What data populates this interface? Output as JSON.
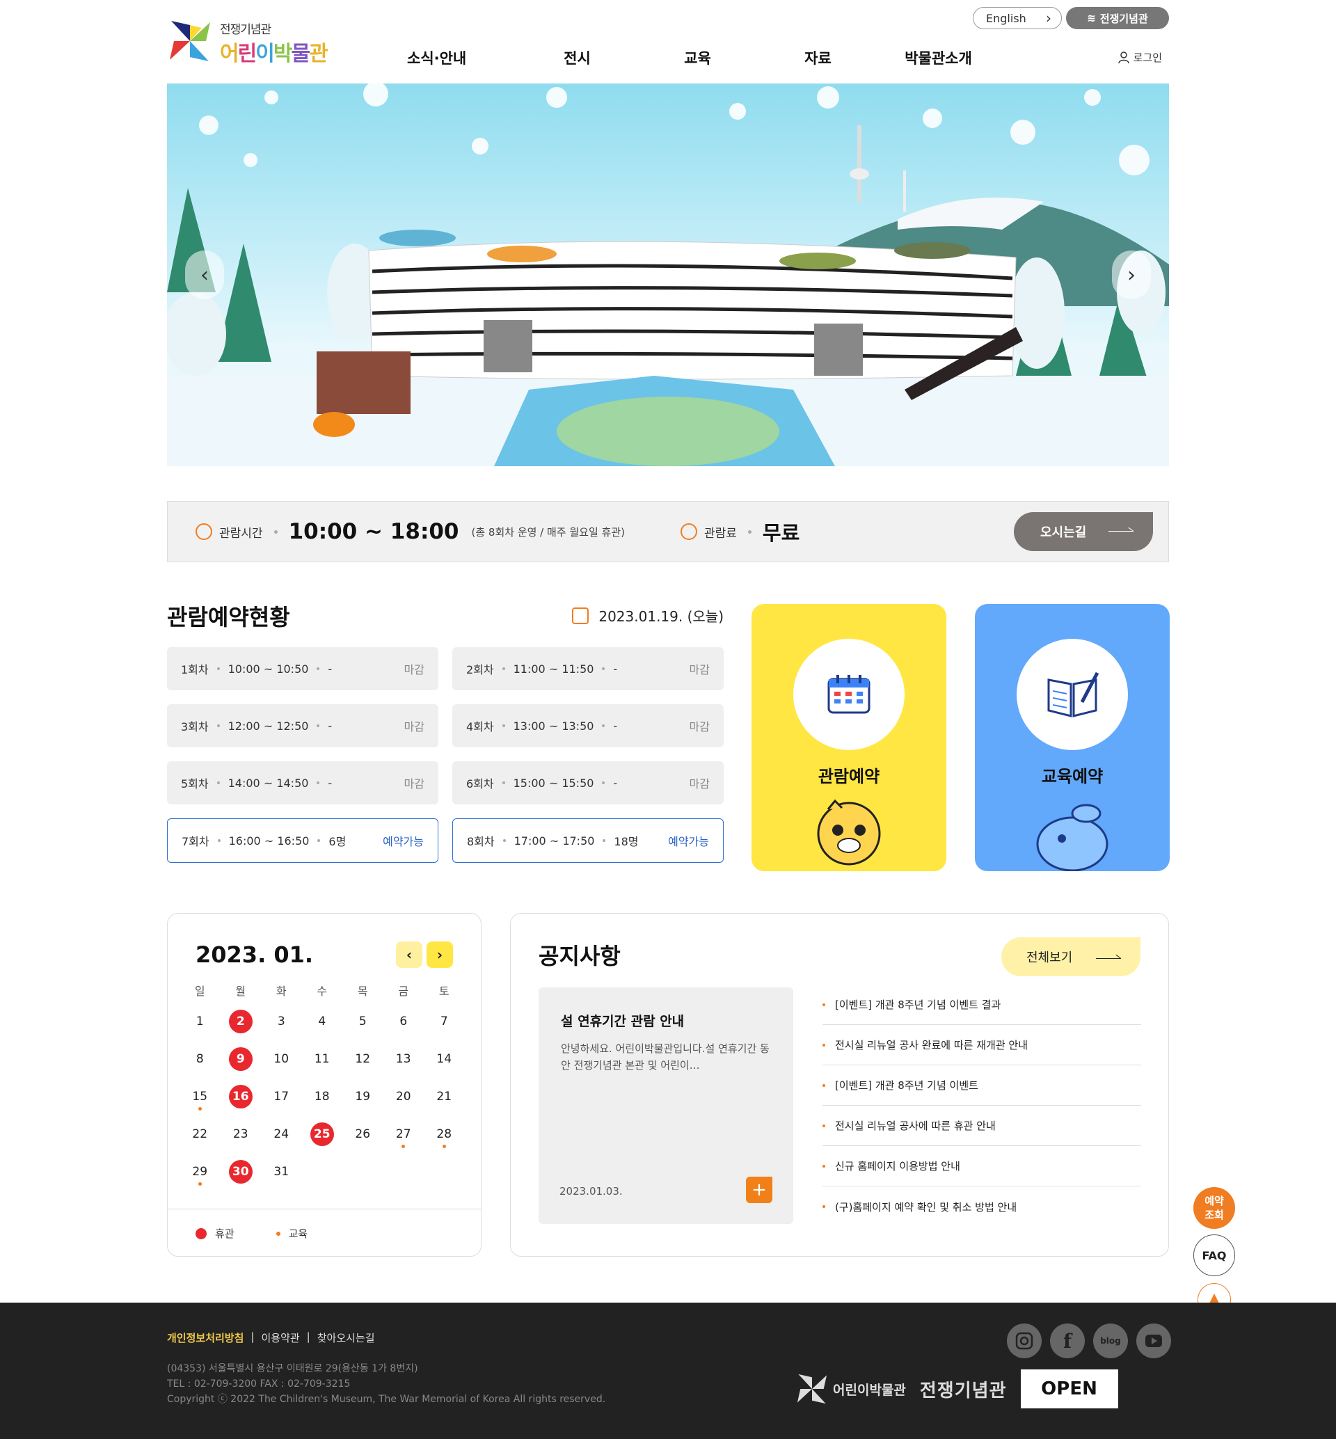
{
  "header": {
    "logo_small": "전쟁기념관",
    "logo_main_chars": [
      "어",
      "린",
      "이",
      "박",
      "물",
      "관"
    ],
    "english_label": "English",
    "war_memorial_label": "전쟁기념관",
    "login_label": "로그인",
    "nav": [
      "소식·안내",
      "전시",
      "교육",
      "자료",
      "박물관소개"
    ]
  },
  "hero": {
    "prev_label": "‹",
    "next_label": "›"
  },
  "infobar": {
    "hours_label": "관람시간",
    "hours_value": "10:00 ~ 18:00",
    "hours_note": "(총 8회차 운영 / 매주 월요일 휴관)",
    "fee_label": "관람료",
    "fee_value": "무료",
    "directions_label": "오시는길"
  },
  "reservation": {
    "title": "관람예약현황",
    "date": "2023.01.19. (오늘)",
    "slots": [
      {
        "round": "1회차",
        "time": "10:00 ~ 10:50",
        "count": "-",
        "status": "마감",
        "open": false
      },
      {
        "round": "2회차",
        "time": "11:00 ~ 11:50",
        "count": "-",
        "status": "마감",
        "open": false
      },
      {
        "round": "3회차",
        "time": "12:00 ~ 12:50",
        "count": "-",
        "status": "마감",
        "open": false
      },
      {
        "round": "4회차",
        "time": "13:00 ~ 13:50",
        "count": "-",
        "status": "마감",
        "open": false
      },
      {
        "round": "5회차",
        "time": "14:00 ~ 14:50",
        "count": "-",
        "status": "마감",
        "open": false
      },
      {
        "round": "6회차",
        "time": "15:00 ~ 15:50",
        "count": "-",
        "status": "마감",
        "open": false
      },
      {
        "round": "7회차",
        "time": "16:00 ~ 16:50",
        "count": "6명",
        "status": "예약가능",
        "open": true
      },
      {
        "round": "8회차",
        "time": "17:00 ~ 17:50",
        "count": "18명",
        "status": "예약가능",
        "open": true
      }
    ],
    "colors": {
      "open_border": "#2f6fd2",
      "open_text": "#2a63c9"
    }
  },
  "cards": {
    "visit": {
      "title": "관람예약",
      "color": "#ffe643",
      "icon": "calendar-icon"
    },
    "edu": {
      "title": "교육예약",
      "color": "#62a8fb",
      "icon": "book-icon"
    }
  },
  "calendar": {
    "title": "2023. 01.",
    "prev_label": "‹",
    "next_label": "›",
    "weekdays": [
      "일",
      "월",
      "화",
      "수",
      "목",
      "금",
      "토"
    ],
    "weeks": [
      [
        {
          "d": "1"
        },
        {
          "d": "2",
          "closed": true
        },
        {
          "d": "3"
        },
        {
          "d": "4"
        },
        {
          "d": "5"
        },
        {
          "d": "6"
        },
        {
          "d": "7"
        }
      ],
      [
        {
          "d": "8"
        },
        {
          "d": "9",
          "closed": true
        },
        {
          "d": "10"
        },
        {
          "d": "11"
        },
        {
          "d": "12"
        },
        {
          "d": "13"
        },
        {
          "d": "14"
        }
      ],
      [
        {
          "d": "15",
          "edu": true
        },
        {
          "d": "16",
          "closed": true
        },
        {
          "d": "17"
        },
        {
          "d": "18"
        },
        {
          "d": "19"
        },
        {
          "d": "20"
        },
        {
          "d": "21"
        }
      ],
      [
        {
          "d": "22"
        },
        {
          "d": "23"
        },
        {
          "d": "24"
        },
        {
          "d": "25",
          "closed": true
        },
        {
          "d": "26"
        },
        {
          "d": "27",
          "edu": true
        },
        {
          "d": "28",
          "edu": true
        }
      ],
      [
        {
          "d": "29",
          "edu": true
        },
        {
          "d": "30",
          "closed": true
        },
        {
          "d": "31"
        }
      ]
    ],
    "legend_closed": "휴관",
    "legend_edu": "교육",
    "colors": {
      "closed": "#e8282e",
      "edu": "#f07d22"
    }
  },
  "notice": {
    "title": "공지사항",
    "view_all_label": "전체보기",
    "featured": {
      "title": "설 연휴기간 관람 안내",
      "body": "안녕하세요. 어린이박물관입니다.설 연휴기간 동안 전쟁기념관 본관 및 어린이…",
      "date": "2023.01.03.",
      "more_label": "+"
    },
    "items": [
      "[이벤트] 개관 8주년 기념 이벤트 결과",
      "전시실 리뉴얼 공사 완료에 따른 재개관 안내",
      "[이벤트] 개관 8주년 기념 이벤트",
      "전시실 리뉴얼 공사에 따른 휴관 안내",
      "신규 홈페이지 이용방법 안내",
      "(구)홈페이지 예약 확인 및 취소 방법 안내"
    ]
  },
  "quick": {
    "reservation_check": "예약\n조회",
    "faq": "FAQ"
  },
  "footer": {
    "links": [
      "개인정보처리방침",
      "이용약관",
      "찾아오시는길"
    ],
    "address": "(04353) 서울특별시 용산구 이태원로 29(용산동 1가 8번지)",
    "tel": "TEL : 02-709-3200 FAX : 02-709-3215",
    "copyright": "Copyright ⓒ 2022 The Children's Museum, The War Memorial of Korea All rights reserved.",
    "sns": [
      "instagram-icon",
      "facebook-icon",
      "blog-icon",
      "youtube-icon"
    ],
    "blog_label": "blog",
    "logo_museum": "어린이박물관",
    "logo_war": "전쟁기념관",
    "logo_open": "OPEN"
  }
}
